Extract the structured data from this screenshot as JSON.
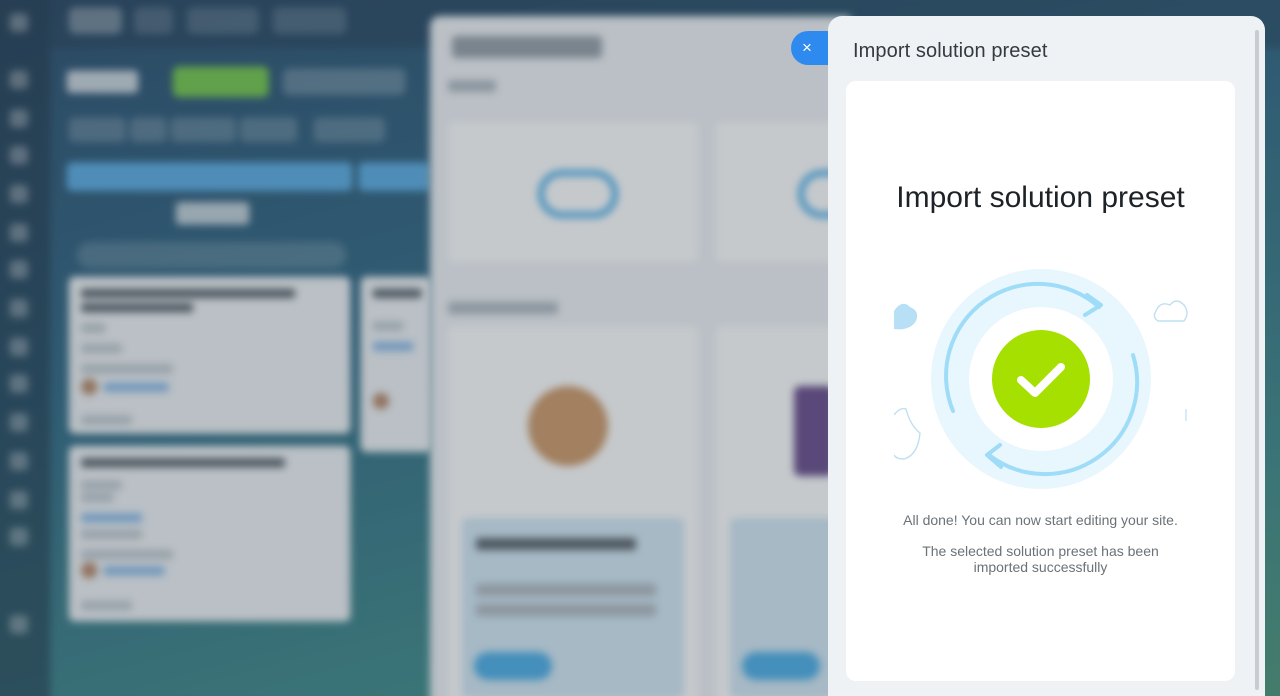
{
  "slider": {
    "title": "Import solution preset",
    "headline": "Import solution preset",
    "message_done": "All done! You can now start editing your site.",
    "message_success": "The selected solution preset has been imported successfully",
    "close_icon": "×"
  },
  "icons": {
    "close": "close-icon",
    "success": "checkmark-circle-icon",
    "cloud": "cloud-icon"
  },
  "colors": {
    "accent_blue": "#2f8af0",
    "success_green": "#a6e000",
    "ring_light": "#e7f6fd",
    "panel_bg": "#eef2f5"
  }
}
